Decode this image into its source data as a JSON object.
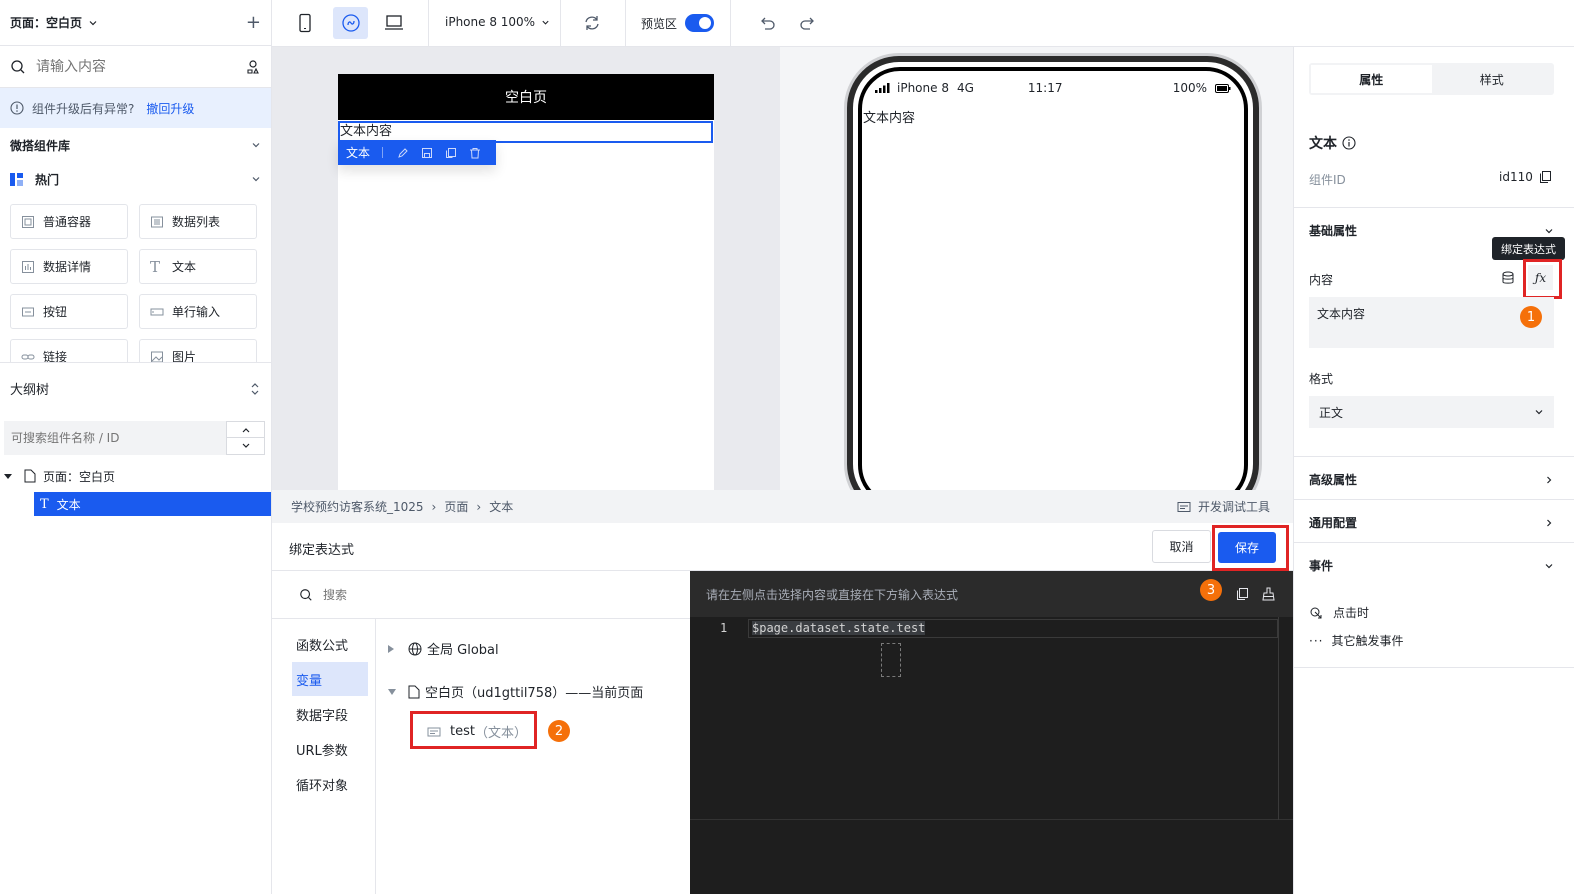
{
  "left": {
    "page_select": "页面：空白页",
    "search_placeholder": "请输入内容",
    "upgrade_notice": "组件升级后有异常?",
    "upgrade_revert": "撤回升级",
    "library_title": "微搭组件库",
    "hot_group": "热门",
    "components": [
      "普通容器",
      "数据列表",
      "数据详情",
      "文本",
      "按钮",
      "单行输入",
      "链接",
      "图片"
    ],
    "outline_title": "大纲树",
    "outline_search_placeholder": "可搜索组件名称 / ID",
    "tree": {
      "page": "页面：空白页",
      "child": "文本"
    }
  },
  "toolbar": {
    "device": "iPhone 8 100%",
    "preview_label": "预览区"
  },
  "canvas": {
    "page_title": "空白页",
    "text_content": "文本内容",
    "selected_tag": "文本",
    "phone": {
      "carrier": "iPhone 8",
      "network": "4G",
      "time": "11:17",
      "battery": "100%",
      "text": "文本内容"
    }
  },
  "breadcrumb": {
    "items": [
      "学校预约访客系统_1025",
      "页面",
      "文本"
    ],
    "dev_tools": "开发调试工具"
  },
  "dialog": {
    "title": "绑定表达式",
    "cancel": "取消",
    "save": "保存",
    "search_placeholder": "搜索",
    "categories": [
      "函数公式",
      "变量",
      "数据字段",
      "URL参数",
      "循环对象"
    ],
    "tree_global": "全局 Global",
    "tree_page": "空白页（ud1gttil758）——当前页面",
    "var_name": "test",
    "var_type": "（文本）",
    "editor_hint": "请在左侧点击选择内容或直接在下方输入表达式",
    "line_number": "1",
    "code": "$page.dataset.state.test"
  },
  "right": {
    "tabs": [
      "属性",
      "样式"
    ],
    "comp_name": "文本",
    "comp_id_label": "组件ID",
    "comp_id": "id110",
    "basic_section": "基础属性",
    "tooltip": "绑定表达式",
    "content_label": "内容",
    "content_value": "文本内容",
    "format_label": "格式",
    "format_value": "正文",
    "advanced": "高级属性",
    "general": "通用配置",
    "events": "事件",
    "event_click": "点击时",
    "event_other": "其它触发事件"
  },
  "badges": [
    "1",
    "2",
    "3"
  ],
  "colors": {
    "primary": "#1a5bef",
    "highlight": "#e02424",
    "badge": "#f5700a",
    "editor_bg": "#1e1e1e"
  }
}
